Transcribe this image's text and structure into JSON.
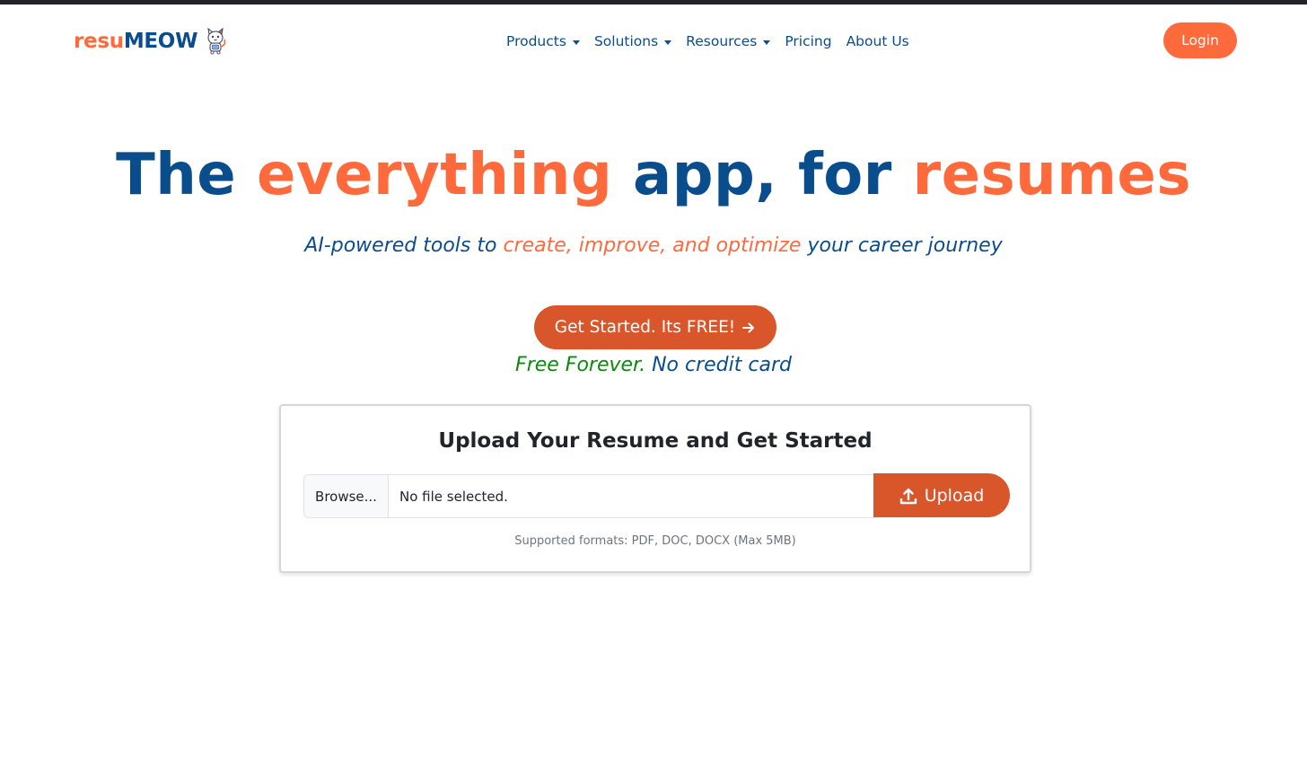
{
  "brand": {
    "part1": "resu",
    "part2": "MEOW",
    "logo_icon": "cat-mascot-icon"
  },
  "nav": {
    "items": [
      {
        "label": "Products",
        "dropdown": true
      },
      {
        "label": "Solutions",
        "dropdown": true
      },
      {
        "label": "Resources",
        "dropdown": true
      },
      {
        "label": "Pricing",
        "dropdown": false
      },
      {
        "label": "About Us",
        "dropdown": false
      }
    ],
    "login_label": "Login"
  },
  "hero": {
    "title_1": "The",
    "title_2": "everything",
    "title_3": "app, for",
    "title_4": "resumes",
    "subtitle_1": "AI-powered tools to",
    "subtitle_2": "create, improve, and optimize",
    "subtitle_3": "your career journey",
    "cta_label": "Get Started. Its FREE!",
    "free_1": "Free Forever.",
    "free_2": "No credit card"
  },
  "upload": {
    "title": "Upload Your Resume and Get Started",
    "browse_label": "Browse...",
    "file_status": "No file selected.",
    "button_label": "Upload",
    "formats_note": "Supported formats: PDF, DOC, DOCX (Max 5MB)"
  },
  "colors": {
    "primary_blue": "#0a4d8c",
    "accent_orange": "#ff6a3d",
    "button_orange": "#d9562b",
    "green": "#0d8a0d",
    "top_bar": "#212529"
  }
}
